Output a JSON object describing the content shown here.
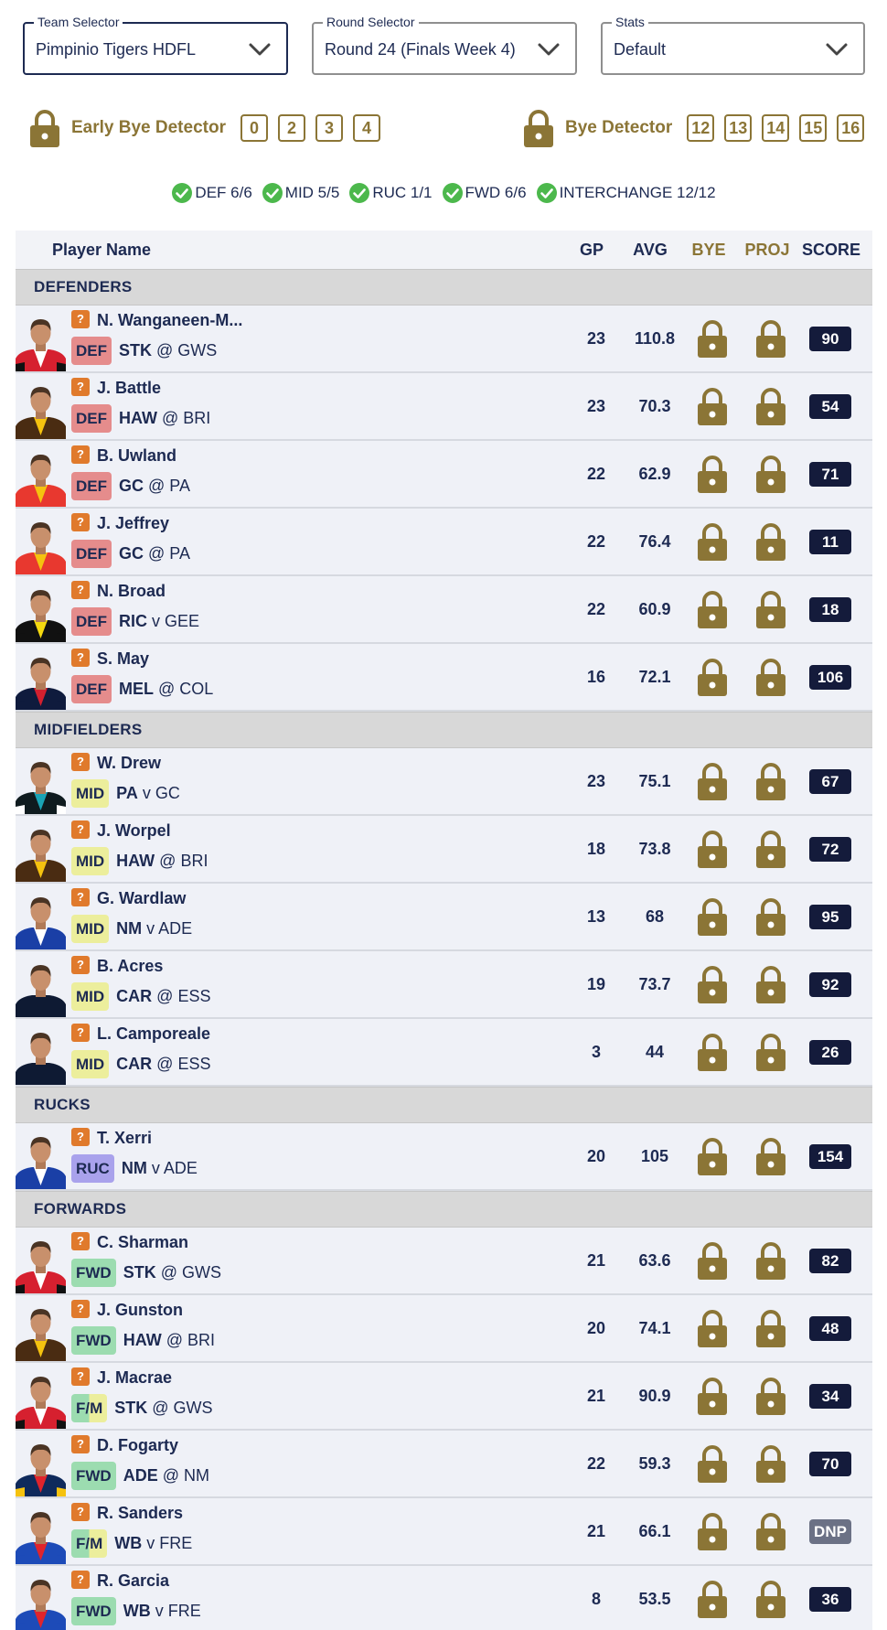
{
  "selectors": {
    "team": {
      "legend": "Team Selector",
      "value": "Pimpinio Tigers HDFL"
    },
    "round": {
      "legend": "Round Selector",
      "value": "Round 24 (Finals Week 4)"
    },
    "stats": {
      "legend": "Stats",
      "value": "Default"
    }
  },
  "early_bye": {
    "label": "Early Bye Detector",
    "rounds": [
      "0",
      "2",
      "3",
      "4"
    ]
  },
  "bye": {
    "label": "Bye Detector",
    "rounds": [
      "12",
      "13",
      "14",
      "15",
      "16"
    ]
  },
  "position_checks": [
    "DEF 6/6",
    "MID 5/5",
    "RUC 1/1",
    "FWD 6/6",
    "INTERCHANGE 12/12"
  ],
  "table": {
    "headers": {
      "name": "Player Name",
      "gp": "GP",
      "avg": "AVG",
      "bye": "BYE",
      "proj": "PROJ",
      "score": "SCORE"
    },
    "sections": [
      {
        "title": "DEFENDERS",
        "players": [
          {
            "badge": "?",
            "name": "N. Wanganeen-M...",
            "pos": "DEF",
            "team": "STK",
            "opp": "@ GWS",
            "gp": "23",
            "avg": "110.8",
            "score": "90"
          },
          {
            "badge": "?",
            "name": "J. Battle",
            "pos": "DEF",
            "team": "HAW",
            "opp": "@ BRI",
            "gp": "23",
            "avg": "70.3",
            "score": "54"
          },
          {
            "badge": "?",
            "name": "B. Uwland",
            "pos": "DEF",
            "team": "GC",
            "opp": "@ PA",
            "gp": "22",
            "avg": "62.9",
            "score": "71"
          },
          {
            "badge": "?",
            "name": "J. Jeffrey",
            "pos": "DEF",
            "team": "GC",
            "opp": "@ PA",
            "gp": "22",
            "avg": "76.4",
            "score": "11"
          },
          {
            "badge": "?",
            "name": "N. Broad",
            "pos": "DEF",
            "team": "RIC",
            "opp": "v GEE",
            "gp": "22",
            "avg": "60.9",
            "score": "18"
          },
          {
            "badge": "?",
            "name": "S. May",
            "pos": "DEF",
            "team": "MEL",
            "opp": "@ COL",
            "gp": "16",
            "avg": "72.1",
            "score": "106"
          }
        ]
      },
      {
        "title": "MIDFIELDERS",
        "players": [
          {
            "badge": "?",
            "name": "W. Drew",
            "pos": "MID",
            "team": "PA",
            "opp": "v GC",
            "gp": "23",
            "avg": "75.1",
            "score": "67"
          },
          {
            "badge": "?",
            "name": "J. Worpel",
            "pos": "MID",
            "team": "HAW",
            "opp": "@ BRI",
            "gp": "18",
            "avg": "73.8",
            "score": "72"
          },
          {
            "badge": "?",
            "name": "G. Wardlaw",
            "pos": "MID",
            "team": "NM",
            "opp": "v ADE",
            "gp": "13",
            "avg": "68",
            "score": "95"
          },
          {
            "badge": "?",
            "name": "B. Acres",
            "pos": "MID",
            "team": "CAR",
            "opp": "@ ESS",
            "gp": "19",
            "avg": "73.7",
            "score": "92"
          },
          {
            "badge": "?",
            "name": "L. Camporeale",
            "pos": "MID",
            "team": "CAR",
            "opp": "@ ESS",
            "gp": "3",
            "avg": "44",
            "score": "26"
          }
        ]
      },
      {
        "title": "RUCKS",
        "players": [
          {
            "badge": "?",
            "name": "T. Xerri",
            "pos": "RUC",
            "team": "NM",
            "opp": "v ADE",
            "gp": "20",
            "avg": "105",
            "score": "154"
          }
        ]
      },
      {
        "title": "FORWARDS",
        "players": [
          {
            "badge": "?",
            "name": "C. Sharman",
            "pos": "FWD",
            "team": "STK",
            "opp": "@ GWS",
            "gp": "21",
            "avg": "63.6",
            "score": "82"
          },
          {
            "badge": "?",
            "name": "J. Gunston",
            "pos": "FWD",
            "team": "HAW",
            "opp": "@ BRI",
            "gp": "20",
            "avg": "74.1",
            "score": "48"
          },
          {
            "badge": "?",
            "name": "J. Macrae",
            "pos": "F/M",
            "team": "STK",
            "opp": "@ GWS",
            "gp": "21",
            "avg": "90.9",
            "score": "34"
          },
          {
            "badge": "?",
            "name": "D. Fogarty",
            "pos": "FWD",
            "team": "ADE",
            "opp": "@ NM",
            "gp": "22",
            "avg": "59.3",
            "score": "70"
          },
          {
            "badge": "?",
            "name": "R. Sanders",
            "pos": "F/M",
            "team": "WB",
            "opp": "v FRE",
            "gp": "21",
            "avg": "66.1",
            "score": "DNP"
          },
          {
            "badge": "?",
            "name": "R. Garcia",
            "pos": "FWD",
            "team": "WB",
            "opp": "v FRE",
            "gp": "8",
            "avg": "53.5",
            "score": "36"
          }
        ]
      }
    ]
  },
  "team_colors": {
    "STK": [
      "#d6202f",
      "#ffffff",
      "#111111"
    ],
    "HAW": [
      "#4a2c12",
      "#f5c20f",
      "#4a2c12"
    ],
    "GC": [
      "#e8382f",
      "#f5c20f",
      "#e8382f"
    ],
    "RIC": [
      "#111111",
      "#f5d90f",
      "#111111"
    ],
    "MEL": [
      "#0f1b3d",
      "#d3202f",
      "#0f1b3d"
    ],
    "PA": [
      "#0f1b1f",
      "#1aa3b5",
      "#ffffff"
    ],
    "NM": [
      "#1a3fa6",
      "#ffffff",
      "#1a3fa6"
    ],
    "CAR": [
      "#0e1a33",
      "#0e1a33",
      "#0e1a33"
    ],
    "ADE": [
      "#0f2a5c",
      "#e0242c",
      "#f5c20f"
    ],
    "WB": [
      "#1d4bb8",
      "#e0242c",
      "#1d4bb8"
    ]
  },
  "colors": {
    "accent": "#1d2a52",
    "gold": "#8b7536",
    "check": "#4cb84c",
    "badge": "#e07a2c"
  }
}
